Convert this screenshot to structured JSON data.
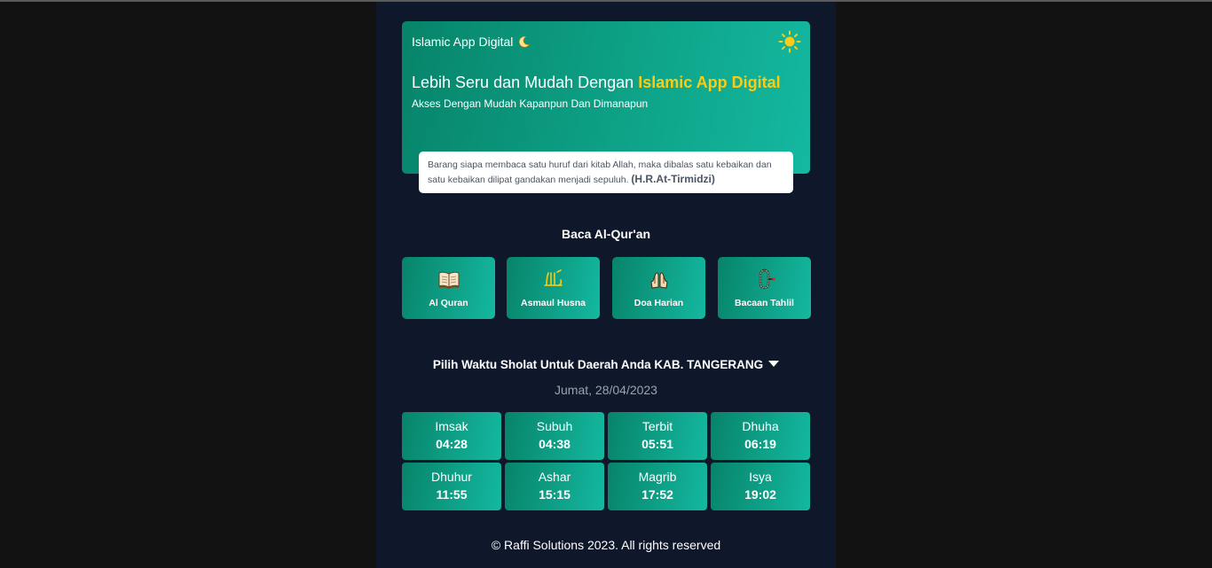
{
  "hero": {
    "brand": "Islamic App Digital",
    "title_prefix": "Lebih Seru dan Mudah Dengan",
    "title_accent": "Islamic App Digital",
    "subtitle": "Akses Dengan Mudah Kapanpun Dan Dimanapun",
    "hadith_text": "Barang siapa membaca satu huruf dari kitab Allah, maka dibalas satu kebaikan dan satu kebaikan dilipat gandakan menjadi sepuluh.",
    "hadith_source": "(H.R.At-Tirmidzi)",
    "brand_icon": "crescent-moon-icon",
    "theme_toggle_icon": "sun-icon"
  },
  "menu": {
    "title": "Baca Al-Qur'an",
    "items": [
      {
        "label": "Al Quran",
        "icon": "open-book-icon"
      },
      {
        "label": "Asmaul Husna",
        "icon": "allah-calligraphy-icon"
      },
      {
        "label": "Doa Harian",
        "icon": "praying-hands-icon"
      },
      {
        "label": "Bacaan Tahlil",
        "icon": "prayer-beads-icon"
      }
    ]
  },
  "prayer": {
    "heading": "Pilih Waktu Sholat Untuk Daerah Anda KAB. TANGERANG",
    "date": "Jumat, 28/04/2023",
    "times": [
      {
        "name": "Imsak",
        "time": "04:28"
      },
      {
        "name": "Subuh",
        "time": "04:38"
      },
      {
        "name": "Terbit",
        "time": "05:51"
      },
      {
        "name": "Dhuha",
        "time": "06:19"
      },
      {
        "name": "Dhuhur",
        "time": "11:55"
      },
      {
        "name": "Ashar",
        "time": "15:15"
      },
      {
        "name": "Magrib",
        "time": "17:52"
      },
      {
        "name": "Isya",
        "time": "19:02"
      }
    ]
  },
  "footer": {
    "text": "© Raffi Solutions 2023. All rights reserved"
  },
  "colors": {
    "page_bg": "#121212",
    "app_bg": "#0f172a",
    "accent_yellow": "#facc15",
    "card_gradient_start": "#07846a",
    "card_gradient_end": "#14b8a0"
  }
}
